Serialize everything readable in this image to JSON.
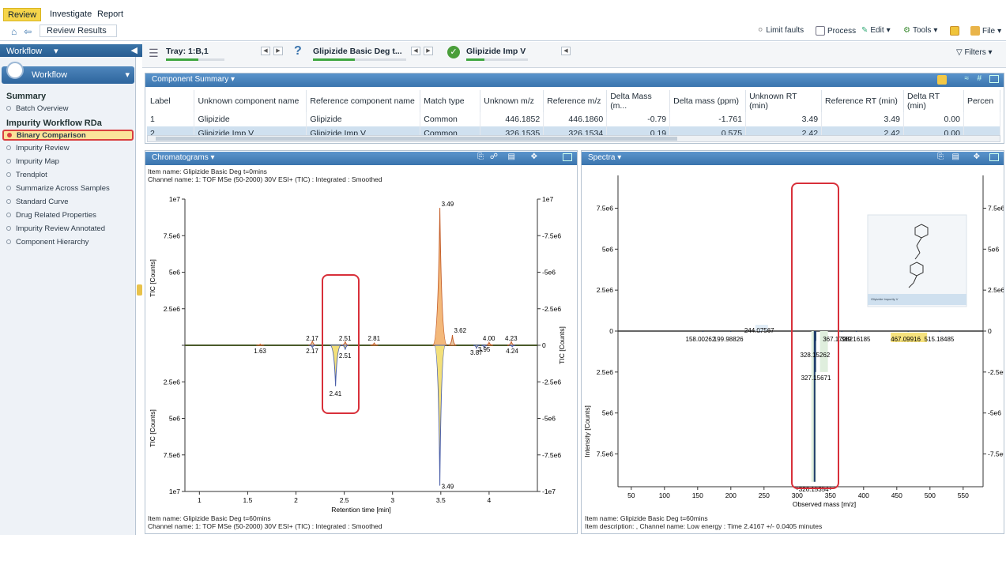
{
  "ribbon": {
    "tabs": [
      "Review",
      "Investigate",
      "Report"
    ],
    "active_tab": "Review"
  },
  "breadcrumb": "Review Results",
  "tools": [
    "Limit faults",
    "Process",
    "Edit",
    "Tools",
    "File"
  ],
  "sidebar": {
    "header": "Workflow",
    "workflow_button": "Workflow",
    "summary_title": "Summary",
    "summary_items": [
      "Batch Overview"
    ],
    "group_title": "Impurity Workflow RDa",
    "items": [
      "Binary Comparison",
      "Impurity Review",
      "Impurity Map",
      "Trendplot",
      "Summarize Across Samples",
      "Standard Curve",
      "Drug Related Properties",
      "Impurity Review Annotated",
      "Component Hierarchy"
    ],
    "selected": "Binary Comparison"
  },
  "trays": [
    {
      "label": "Tray: 1:B,1",
      "progress": 0.55
    },
    {
      "label": "Glipizide Basic Deg t...",
      "progress": 0.45
    },
    {
      "label": "Glipizide Imp V",
      "progress": 0.3
    }
  ],
  "filters_label": "Filters",
  "component_summary": {
    "title": "Component Summary",
    "columns": [
      "Label",
      "Unknown component name",
      "Reference component name",
      "Match type",
      "Unknown m/z",
      "Reference m/z",
      "Delta Mass (m...",
      "Delta mass (ppm)",
      "Unknown RT (min)",
      "Reference RT (min)",
      "Delta RT (min)",
      "Percen"
    ],
    "rows": [
      [
        "1",
        "Glipizide",
        "Glipizide",
        "Common",
        "446.1852",
        "446.1860",
        "-0.79",
        "-1.761",
        "3.49",
        "3.49",
        "0.00",
        ""
      ],
      [
        "2",
        "Glipizide Imp V",
        "Glipizide Imp V",
        "Common",
        "326.1535",
        "326.1534",
        "0.19",
        "0.575",
        "2.42",
        "2.42",
        "0.00",
        ""
      ]
    ],
    "selected_row": 1
  },
  "chromatograms": {
    "title": "Chromatograms",
    "item_top": "Item name: Glipizide Basic Deg t=0mins",
    "channel_top": "Channel name: 1: TOF MSe (50-2000) 30V ESI+ (TIC) : Integrated : Smoothed",
    "item_bottom": "Item name: Glipizide Basic Deg t=60mins",
    "channel_bottom": "Channel name: 1: TOF MSe (50-2000) 30V ESI+ (TIC) : Integrated : Smoothed",
    "xlabel": "Retention time [min]",
    "ylabel": "TIC [Counts]"
  },
  "spectra": {
    "title": "Spectra",
    "item_bottom": "Item name: Glipizide Basic Deg t=60mins",
    "desc_bottom": "Item description: , Channel name: Low energy : Time 2.4167 +/- 0.0405 minutes",
    "xlabel": "Observed mass [m/z]",
    "ylabel": "Intensity [Counts]",
    "structure_caption": "Glipizide Impurity V"
  },
  "chart_data": [
    {
      "type": "line",
      "title": "Chromatograms",
      "xlabel": "Retention time [min]",
      "ylabel": "TIC [Counts]",
      "xlim": [
        0.85,
        4.5
      ],
      "ylim": [
        -10000000,
        10000000
      ],
      "x_ticks": [
        1,
        1.5,
        2,
        2.5,
        3,
        3.5,
        4
      ],
      "y_ticks_left": [
        "1e7",
        "7.5e6",
        "5e6",
        "2.5e6",
        "",
        "2.5e6",
        "5e6",
        "7.5e6",
        "1e7"
      ],
      "y_ticks_right": [
        "1e7",
        "-7.5e6",
        "-5e6",
        "-2.5e6",
        "0",
        "-2.5e6",
        "-5e6",
        "-7.5e6",
        "-1e7"
      ],
      "series": [
        {
          "name": "Glipizide Basic Deg t=0mins",
          "peaks": [
            {
              "x": 1.63,
              "y": 80000
            },
            {
              "x": 2.17,
              "y": 300000
            },
            {
              "x": 2.51,
              "y": 250000
            },
            {
              "x": 2.81,
              "y": 150000
            },
            {
              "x": 3.49,
              "y": 9400000
            },
            {
              "x": 3.62,
              "y": 700000
            },
            {
              "x": 4.0,
              "y": 200000
            },
            {
              "x": 4.23,
              "y": 250000
            }
          ]
        },
        {
          "name": "Glipizide Basic Deg t=60mins",
          "peaks": [
            {
              "x": 2.17,
              "y": -150000
            },
            {
              "x": 2.41,
              "y": -2800000
            },
            {
              "x": 2.51,
              "y": -300000
            },
            {
              "x": 3.49,
              "y": -9600000
            },
            {
              "x": 3.87,
              "y": -200000
            },
            {
              "x": 3.95,
              "y": -150000
            },
            {
              "x": 4.24,
              "y": -100000
            }
          ]
        }
      ],
      "peak_labels_top": [
        "1.63",
        "2.17",
        "2.51",
        "2.81",
        "3.49",
        "3.62",
        "4.00",
        "4.23"
      ],
      "peak_labels_bottom": [
        "2.17",
        "2.41",
        "2.51",
        "3.49",
        "3.87",
        "3.95",
        "4.24"
      ]
    },
    {
      "type": "bar",
      "title": "Spectra",
      "xlabel": "Observed mass [m/z]",
      "ylabel": "Intensity [Counts]",
      "xlim": [
        30,
        580
      ],
      "ylim": [
        -9500000,
        9500000
      ],
      "x_ticks": [
        50,
        100,
        150,
        200,
        250,
        300,
        350,
        400,
        450,
        500,
        550
      ],
      "y_ticks_left": [
        "7.5e6",
        "5e6",
        "2.5e6",
        "0",
        "2.5e6",
        "5e6",
        "7.5e6"
      ],
      "y_ticks_right": [
        "7.5e6",
        "5e6",
        "2.5e6",
        "0",
        "-2.5e6",
        "-5e6",
        "-7.5e6"
      ],
      "bottom_peaks": [
        {
          "mz": 158.00262,
          "intensity": -50000
        },
        {
          "mz": 199.98826,
          "intensity": -50000
        },
        {
          "mz": 244.07567,
          "intensity": -80000
        },
        {
          "mz": 326.15354,
          "intensity": -9200000
        },
        {
          "mz": 327.15671,
          "intensity": -2500000
        },
        {
          "mz": 328.15262,
          "intensity": -600000
        },
        {
          "mz": 367.17982,
          "intensity": -50000
        },
        {
          "mz": 389.16185,
          "intensity": -50000
        },
        {
          "mz": 467.09916,
          "intensity": -50000
        },
        {
          "mz": 515.18485,
          "intensity": -50000
        }
      ],
      "peak_labels": [
        "158.00262",
        "199.98826",
        "244.07567",
        "328.15262",
        "367.17982",
        "389.16185",
        "467.09916",
        "515.18485",
        "327.15671",
        "326.15354"
      ]
    }
  ]
}
